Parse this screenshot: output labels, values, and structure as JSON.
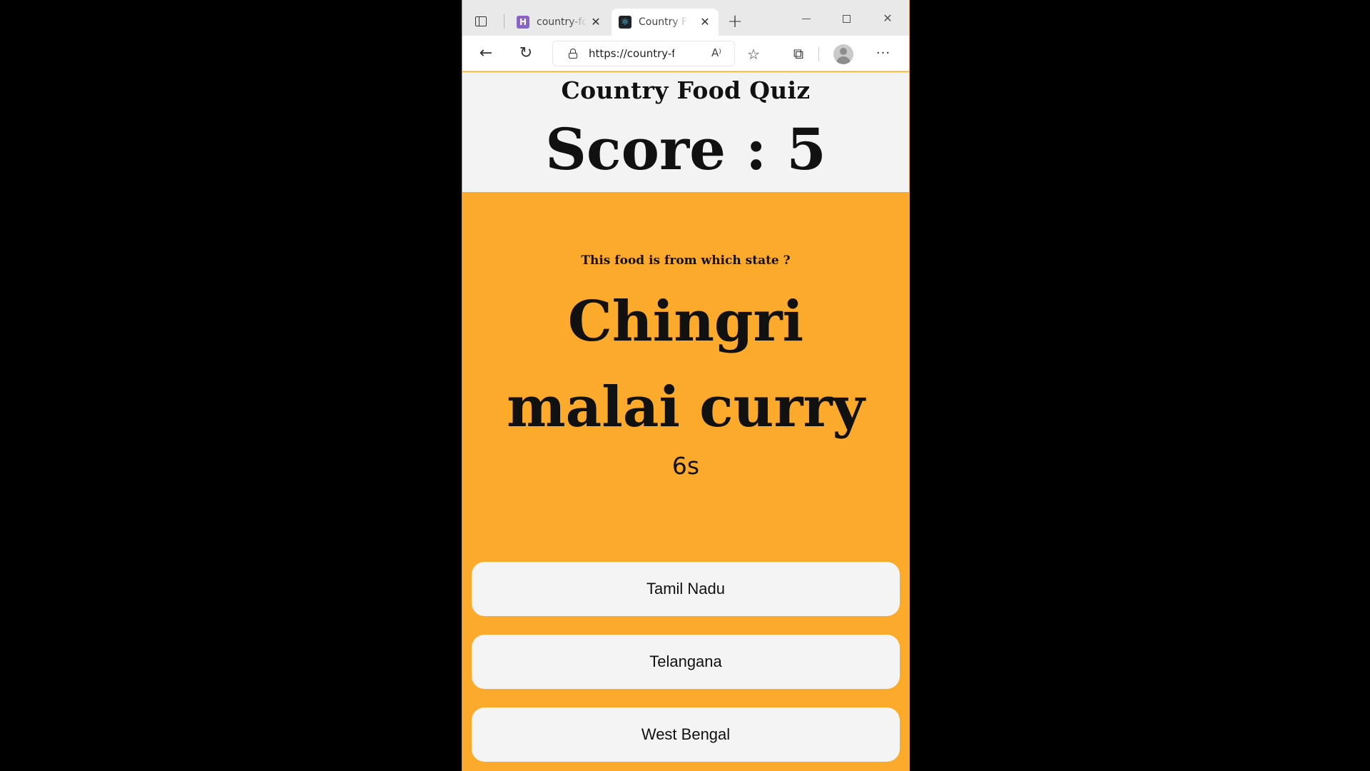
{
  "browser": {
    "tabs": [
      {
        "title": "country-food-quiz",
        "favicon": "H",
        "active": false
      },
      {
        "title": "Country Food Quiz",
        "favicon": "⚛",
        "active": true
      }
    ],
    "new_tab_label": "+",
    "url": "https://country-food-quiz",
    "read_aloud_label": "A⁾",
    "more_label": "···"
  },
  "header": {
    "title": "Country Food Quiz",
    "score": "Score : 5"
  },
  "question": {
    "prompt": "This food is from which state ?",
    "food": "Chingri malai curry",
    "timer": "6s"
  },
  "options": [
    {
      "label": "Tamil Nadu"
    },
    {
      "label": "Telangana"
    },
    {
      "label": "West Bengal"
    }
  ],
  "colors": {
    "page_background": "#fbaa2c",
    "header_background": "#f3f3f3",
    "option_background": "#f4f4f4"
  }
}
